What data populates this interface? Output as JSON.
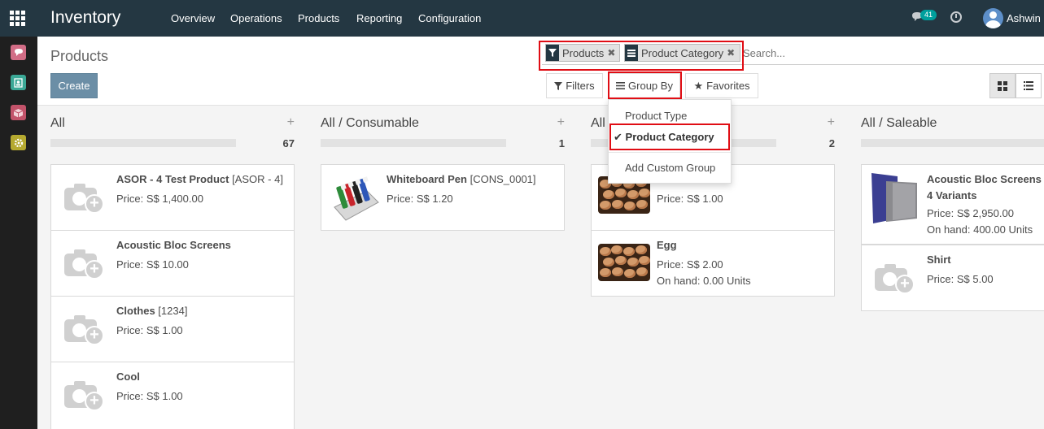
{
  "topbar": {
    "app_title": "Inventory",
    "menu": [
      "Overview",
      "Operations",
      "Products",
      "Reporting",
      "Configuration"
    ],
    "messages_badge": "41",
    "user_name": "Ashwin"
  },
  "sidebar": {
    "icons": [
      "chat-icon",
      "contacts-icon",
      "inventory-box-icon",
      "settings-icon"
    ]
  },
  "control_panel": {
    "breadcrumb_title": "Products",
    "create_label": "Create",
    "facets": [
      {
        "icon": "filter-icon",
        "label": "Products"
      },
      {
        "icon": "group-by-icon",
        "label": "Product Category"
      }
    ],
    "search_placeholder": "Search...",
    "filters_label": "Filters",
    "groupby_label": "Group By",
    "favorites_label": "Favorites"
  },
  "groupby_dropdown": {
    "items": [
      "Product Type",
      "Product Category"
    ],
    "selected": "Product Category",
    "custom_group_label": "Add Custom Group"
  },
  "columns": [
    {
      "title": "All",
      "count": "67",
      "cards": [
        {
          "name": "ASOR - 4 Test Product",
          "ref": "[ASOR - 4]",
          "lines": [
            "Price: S$ 1,400.00"
          ]
        },
        {
          "name": "Acoustic Bloc Screens",
          "ref": "",
          "lines": [
            "Price: S$ 10.00"
          ]
        },
        {
          "name": "Clothes",
          "ref": "[1234]",
          "lines": [
            "Price: S$ 1.00"
          ]
        },
        {
          "name": "Cool",
          "ref": "",
          "lines": [
            "Price: S$ 1.00"
          ]
        }
      ]
    },
    {
      "title": "All / Consumable",
      "count": "1",
      "cards": [
        {
          "name": "Whiteboard Pen",
          "ref": "[CONS_0001]",
          "lines": [
            "Price: S$ 1.20"
          ]
        }
      ]
    },
    {
      "title": "All",
      "count": "2",
      "cards": [
        {
          "name": "",
          "ref": "",
          "lines": [
            "Price: S$ 1.00"
          ]
        },
        {
          "name": "Egg",
          "ref": "",
          "lines": [
            "Price: S$ 2.00",
            "On hand: 0.00 Units"
          ]
        }
      ]
    },
    {
      "title": "All / Saleable",
      "count": "",
      "cards": [
        {
          "name": "Acoustic Bloc Screens",
          "subtitle": "4 Variants",
          "lines": [
            "Price: S$ 2,950.00",
            "On hand: 400.00 Units"
          ]
        },
        {
          "name": "Shirt",
          "ref": "",
          "lines": [
            "Price: S$ 5.00"
          ]
        }
      ]
    }
  ]
}
